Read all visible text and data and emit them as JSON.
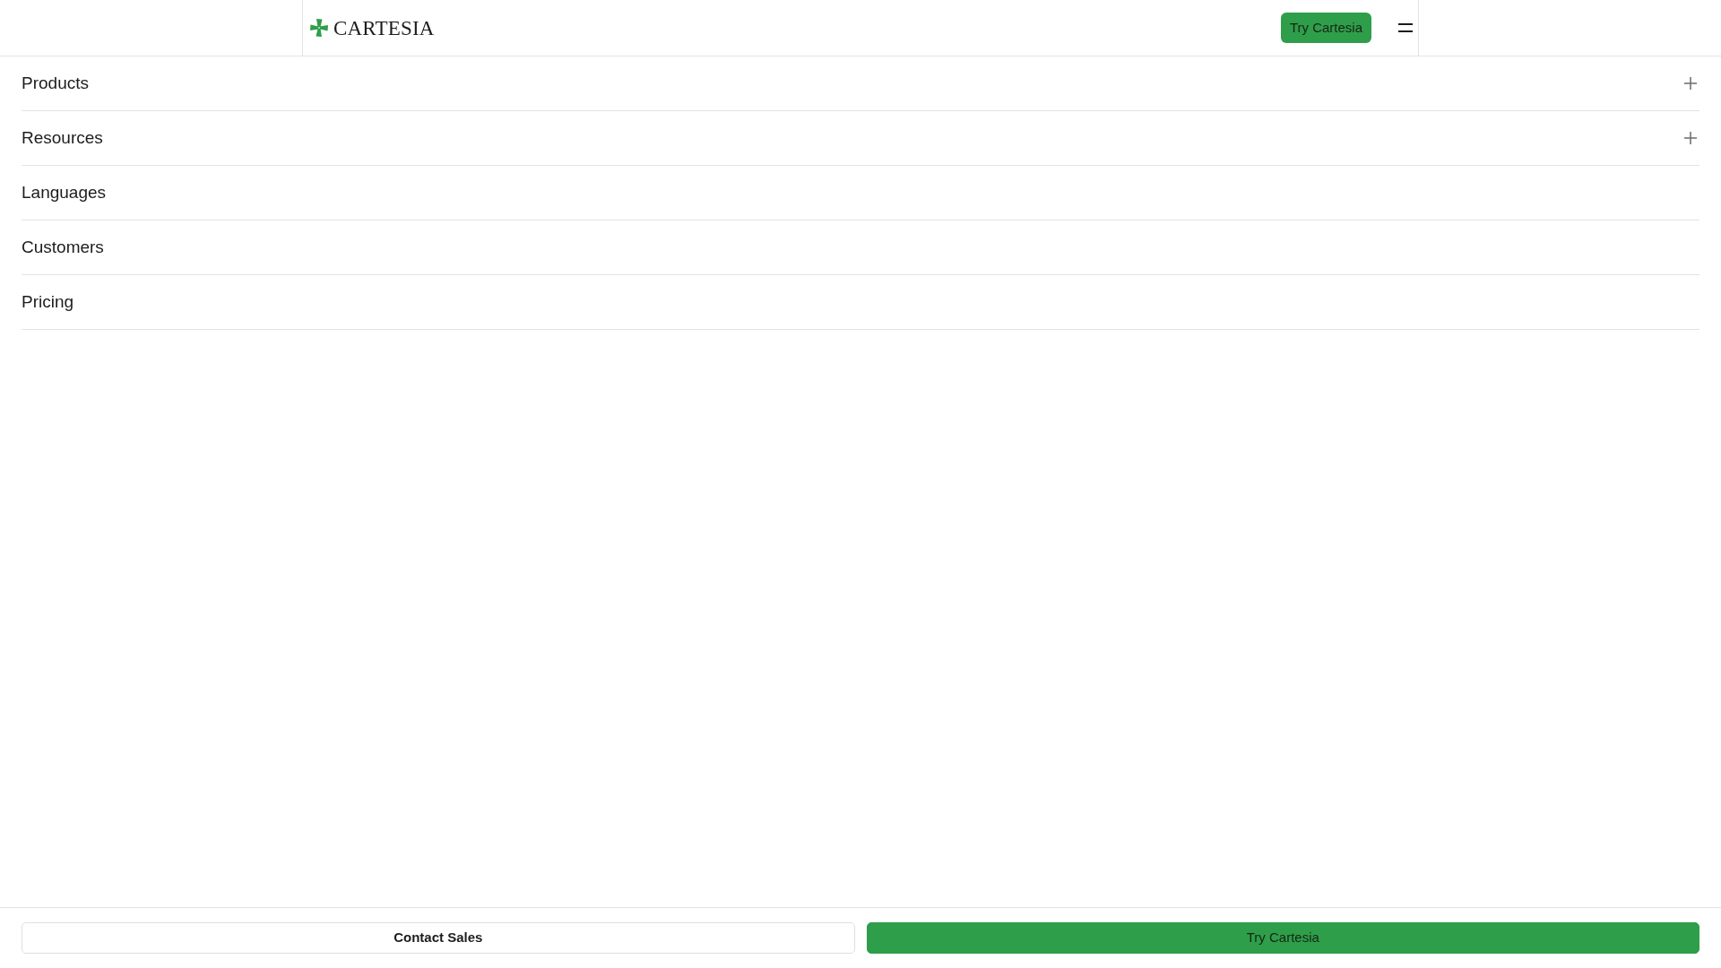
{
  "header": {
    "logo": {
      "text": "CARTESIA"
    },
    "cta": {
      "label": "Try Cartesia"
    }
  },
  "menu": {
    "items": [
      {
        "label": "Products",
        "kind": "group",
        "expanded": false
      },
      {
        "label": "Resources",
        "kind": "group",
        "expanded": false
      },
      {
        "label": "Languages",
        "kind": "link"
      },
      {
        "label": "Customers",
        "kind": "link"
      },
      {
        "label": "Pricing",
        "kind": "link"
      }
    ]
  },
  "footer_actions": [
    {
      "label": "Contact Sales",
      "kind": "secondary"
    },
    {
      "label": "Try Cartesia",
      "kind": "primary"
    }
  ]
}
